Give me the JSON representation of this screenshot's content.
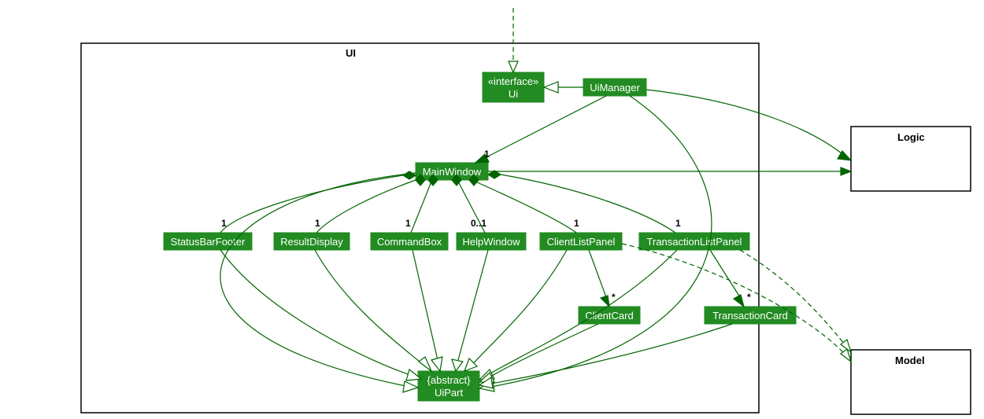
{
  "packages": {
    "ui": {
      "label": "UI"
    },
    "logic": {
      "label": "Logic"
    },
    "model": {
      "label": "Model"
    }
  },
  "nodes": {
    "ui_interface": {
      "line1": "«interface»",
      "line2": "Ui"
    },
    "ui_manager": {
      "label": "UiManager"
    },
    "main_window": {
      "label": "MainWindow"
    },
    "status_bar": {
      "label": "StatusBarFooter"
    },
    "result_display": {
      "label": "ResultDisplay"
    },
    "command_box": {
      "label": "CommandBox"
    },
    "help_window": {
      "label": "HelpWindow"
    },
    "client_list_panel": {
      "label": "ClientListPanel"
    },
    "transaction_list_panel": {
      "label": "TransactionListPanel"
    },
    "client_card": {
      "label": "ClientCard"
    },
    "transaction_card": {
      "label": "TransactionCard"
    },
    "ui_part": {
      "line1": "{abstract}",
      "line2": "UiPart"
    }
  },
  "multiplicities": {
    "mw": "1",
    "status_bar": "1",
    "result_display": "1",
    "command_box": "1",
    "help_window": "0..1",
    "client_list_panel": "1",
    "transaction_list_panel": "1",
    "client_card": "*",
    "transaction_card": "*"
  },
  "colors": {
    "node_fill": "#228B22",
    "node_text": "#ffffff",
    "edge": "#006400"
  },
  "chart_data": {
    "type": "uml_class_diagram",
    "packages": [
      {
        "name": "UI",
        "contains": [
          "Ui",
          "UiManager",
          "MainWindow",
          "StatusBarFooter",
          "ResultDisplay",
          "CommandBox",
          "HelpWindow",
          "ClientListPanel",
          "TransactionListPanel",
          "ClientCard",
          "TransactionCard",
          "UiPart"
        ]
      },
      {
        "name": "Logic",
        "contains": []
      },
      {
        "name": "Model",
        "contains": []
      }
    ],
    "classes": [
      {
        "name": "Ui",
        "stereotype": "interface"
      },
      {
        "name": "UiManager"
      },
      {
        "name": "MainWindow"
      },
      {
        "name": "StatusBarFooter"
      },
      {
        "name": "ResultDisplay"
      },
      {
        "name": "CommandBox"
      },
      {
        "name": "HelpWindow"
      },
      {
        "name": "ClientListPanel"
      },
      {
        "name": "TransactionListPanel"
      },
      {
        "name": "ClientCard"
      },
      {
        "name": "TransactionCard"
      },
      {
        "name": "UiPart",
        "stereotype": "abstract"
      }
    ],
    "relationships": [
      {
        "from": "external_top",
        "to": "Ui",
        "type": "dependency"
      },
      {
        "from": "UiManager",
        "to": "Ui",
        "type": "realization"
      },
      {
        "from": "UiManager",
        "to": "MainWindow",
        "type": "association",
        "multiplicity_to": "1"
      },
      {
        "from": "UiManager",
        "to": "Logic",
        "type": "association"
      },
      {
        "from": "MainWindow",
        "to": "Logic",
        "type": "association"
      },
      {
        "from": "MainWindow",
        "to": "StatusBarFooter",
        "type": "composition",
        "multiplicity_to": "1"
      },
      {
        "from": "MainWindow",
        "to": "ResultDisplay",
        "type": "composition",
        "multiplicity_to": "1"
      },
      {
        "from": "MainWindow",
        "to": "CommandBox",
        "type": "composition",
        "multiplicity_to": "1"
      },
      {
        "from": "MainWindow",
        "to": "HelpWindow",
        "type": "composition",
        "multiplicity_to": "0..1"
      },
      {
        "from": "MainWindow",
        "to": "ClientListPanel",
        "type": "composition",
        "multiplicity_to": "1"
      },
      {
        "from": "MainWindow",
        "to": "TransactionListPanel",
        "type": "composition",
        "multiplicity_to": "1"
      },
      {
        "from": "ClientListPanel",
        "to": "ClientCard",
        "type": "association",
        "multiplicity_to": "*"
      },
      {
        "from": "TransactionListPanel",
        "to": "TransactionCard",
        "type": "association",
        "multiplicity_to": "*"
      },
      {
        "from": "ClientListPanel",
        "to": "Model",
        "type": "dependency"
      },
      {
        "from": "TransactionListPanel",
        "to": "Model",
        "type": "dependency"
      },
      {
        "from": "MainWindow",
        "to": "UiPart",
        "type": "generalization"
      },
      {
        "from": "UiManager",
        "to": "UiPart",
        "type": "generalization"
      },
      {
        "from": "StatusBarFooter",
        "to": "UiPart",
        "type": "generalization"
      },
      {
        "from": "ResultDisplay",
        "to": "UiPart",
        "type": "generalization"
      },
      {
        "from": "CommandBox",
        "to": "UiPart",
        "type": "generalization"
      },
      {
        "from": "HelpWindow",
        "to": "UiPart",
        "type": "generalization"
      },
      {
        "from": "ClientListPanel",
        "to": "UiPart",
        "type": "generalization"
      },
      {
        "from": "TransactionListPanel",
        "to": "UiPart",
        "type": "generalization"
      },
      {
        "from": "ClientCard",
        "to": "UiPart",
        "type": "generalization"
      },
      {
        "from": "TransactionCard",
        "to": "UiPart",
        "type": "generalization"
      }
    ]
  }
}
